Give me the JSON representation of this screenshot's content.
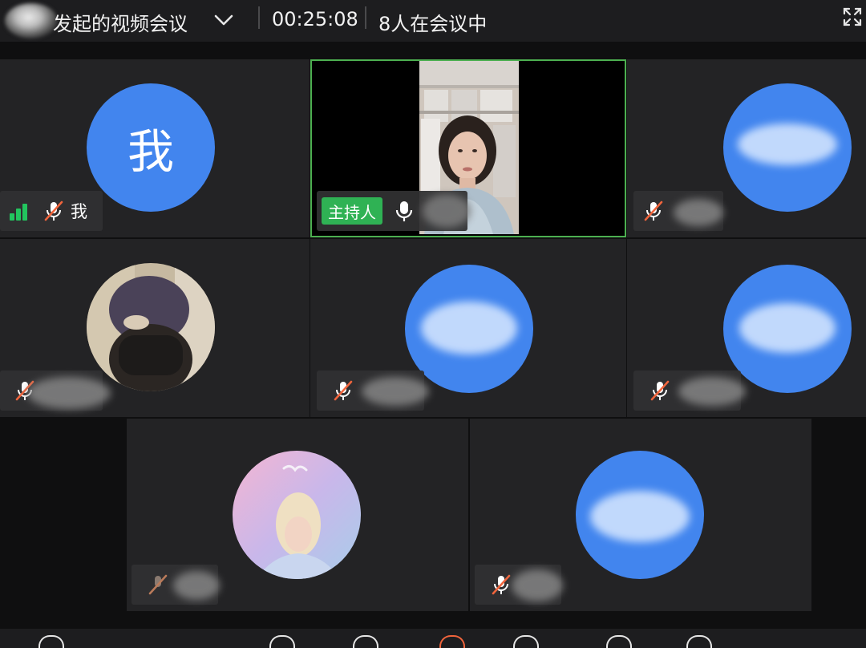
{
  "header": {
    "title": "发起的视频会议",
    "timer": "00:25:08",
    "participants": "8人在会议中"
  },
  "tiles": {
    "self": {
      "avatar_text": "我",
      "name": "我"
    },
    "host": {
      "badge": "主持人"
    }
  },
  "colors": {
    "avatar_blue": "#4285ee",
    "host_green": "#2fb254",
    "active_border": "#4caf50",
    "muted_mic": "#f0643c",
    "signal_green": "#22c55e"
  },
  "icons": [
    "chevron-down-icon",
    "fullscreen-icon",
    "signal-strength-icon",
    "mic-muted-icon",
    "mic-on-icon"
  ]
}
